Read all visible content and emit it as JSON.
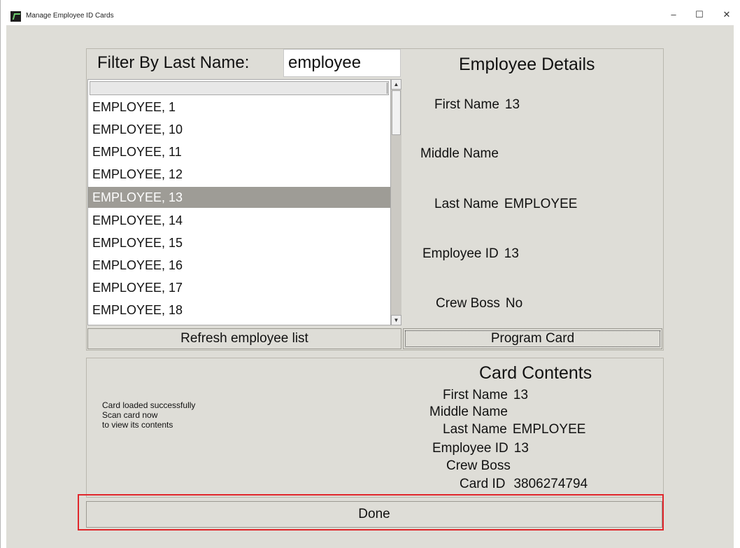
{
  "window": {
    "title": "Manage Employee ID Cards",
    "controls": {
      "minimize": "–",
      "maximize": "☐",
      "close": "✕"
    }
  },
  "filter": {
    "label": "Filter By Last Name:",
    "value": "employee"
  },
  "employee_list": {
    "items": [
      "EMPLOYEE, 1",
      "EMPLOYEE, 10",
      "EMPLOYEE, 11",
      "EMPLOYEE, 12",
      "EMPLOYEE, 13",
      "EMPLOYEE, 14",
      "EMPLOYEE, 15",
      "EMPLOYEE, 16",
      "EMPLOYEE, 17",
      "EMPLOYEE, 18"
    ],
    "selected_index": 4,
    "refresh_label": "Refresh employee list"
  },
  "employee_details": {
    "title": "Employee Details",
    "first_name_label": "First Name",
    "first_name_value": "13",
    "middle_name_label": "Middle Name",
    "middle_name_value": "",
    "last_name_label": "Last Name",
    "last_name_value": "EMPLOYEE",
    "employee_id_label": "Employee ID",
    "employee_id_value": "13",
    "crew_boss_label": "Crew Boss",
    "crew_boss_value": "No",
    "program_label": "Program Card"
  },
  "card_contents": {
    "title": "Card Contents",
    "first_name_label": "First Name",
    "first_name_value": "13",
    "middle_name_label": "Middle Name",
    "middle_name_value": "",
    "last_name_label": "Last Name",
    "last_name_value": "EMPLOYEE",
    "employee_id_label": "Employee ID",
    "employee_id_value": "13",
    "crew_boss_label": "Crew Boss",
    "crew_boss_value": "",
    "card_id_label": "Card ID",
    "card_id_value": "3806274794"
  },
  "status": {
    "line1": "Card loaded successfully",
    "line2": "Scan card now",
    "line3": "to view its contents"
  },
  "done_label": "Done",
  "colors": {
    "background": "#deddd7",
    "selection": "#9e9c96",
    "highlight": "#e0262b"
  }
}
